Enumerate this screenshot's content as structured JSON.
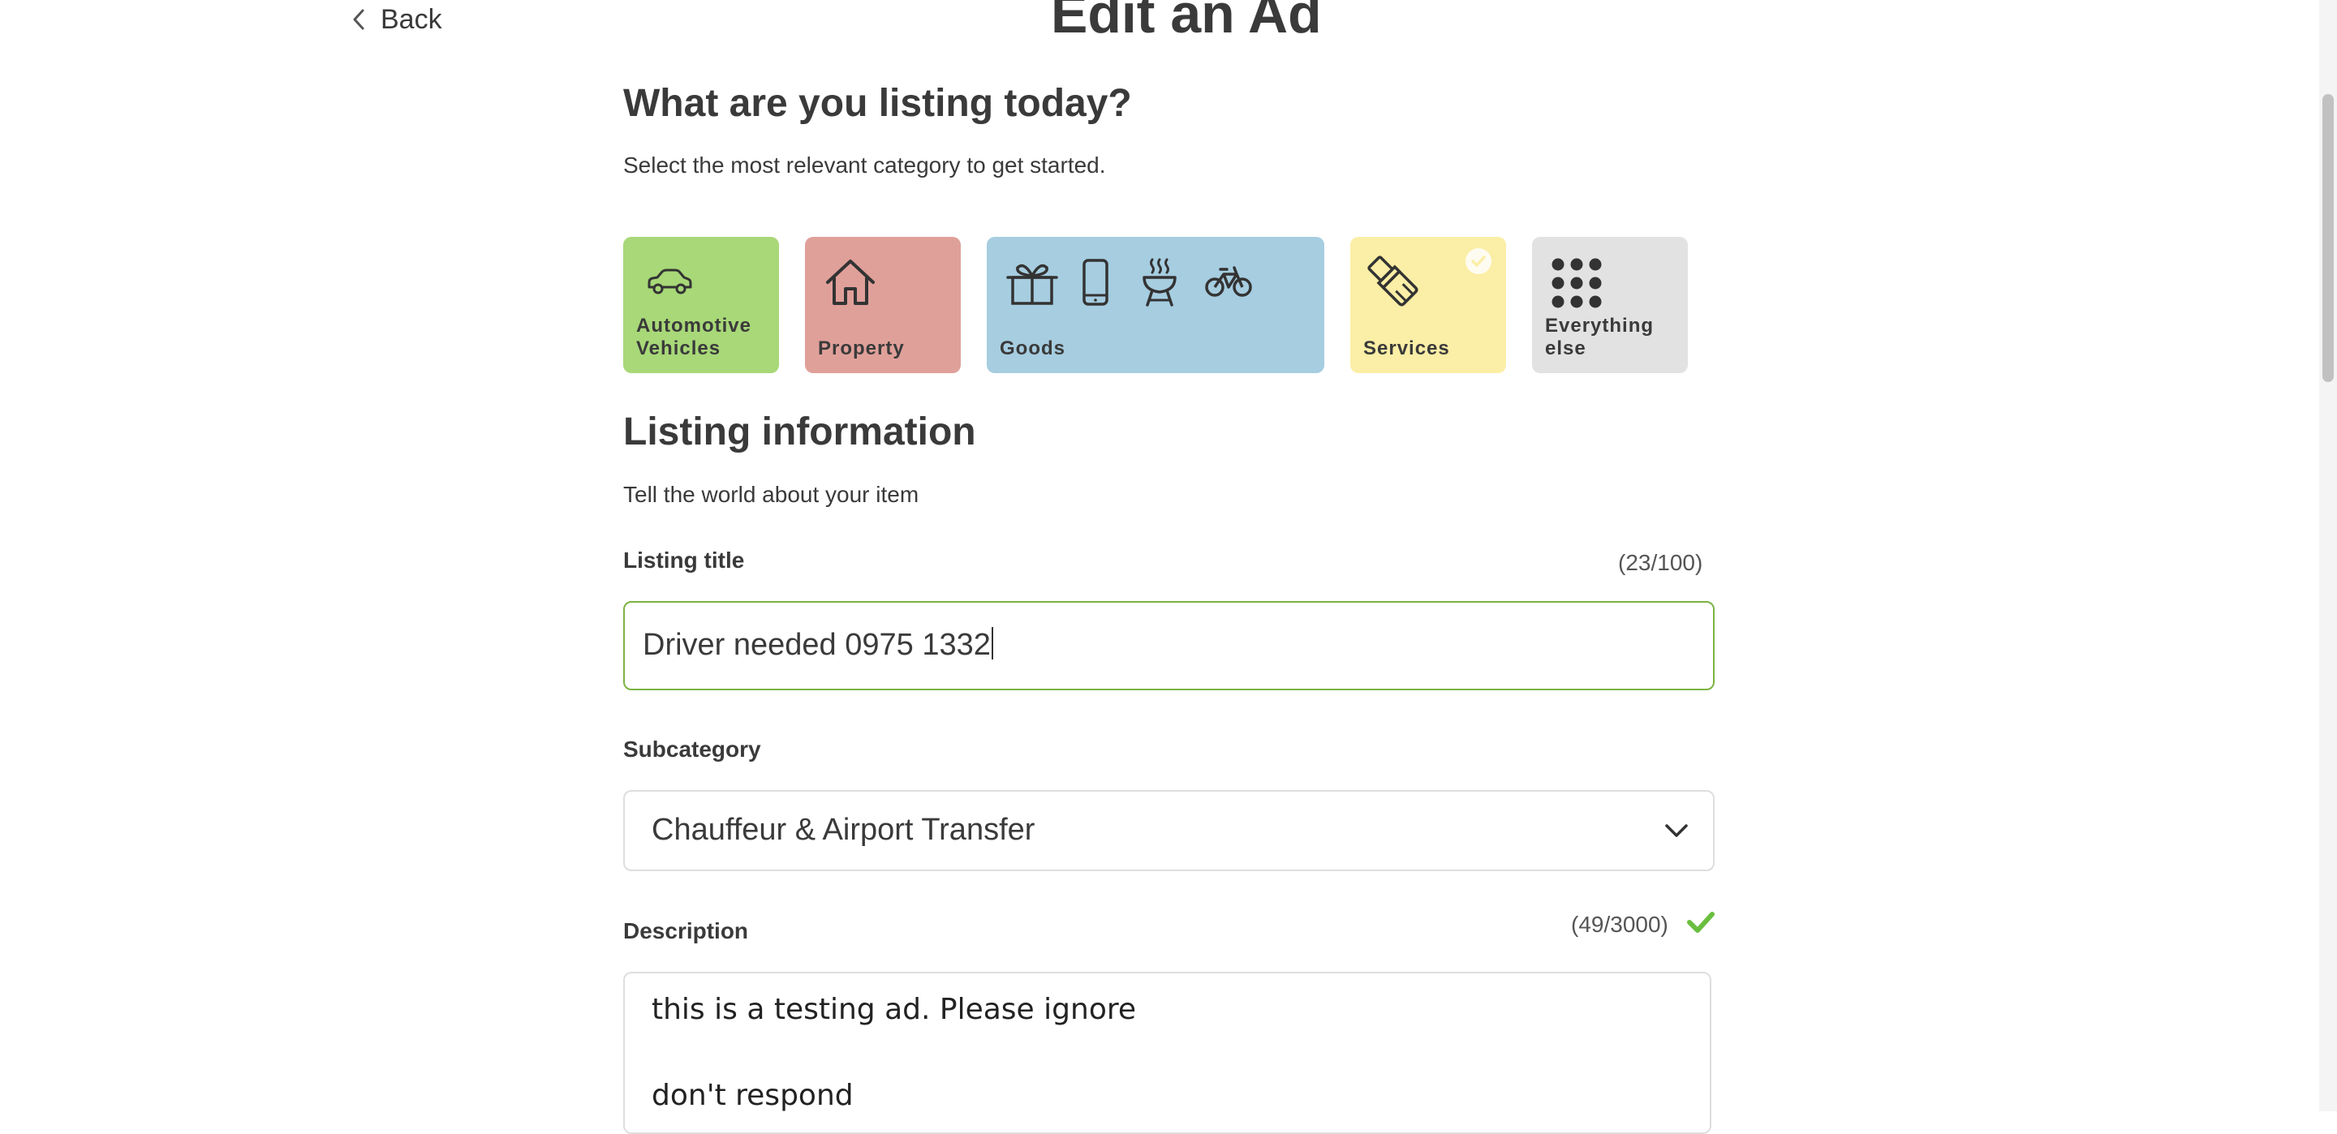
{
  "nav": {
    "back_label": "Back"
  },
  "page": {
    "title": "Edit an Ad"
  },
  "category_section": {
    "heading": "What are you listing today?",
    "subheading": "Select the most relevant category to get started.",
    "tiles": [
      {
        "label": "Automotive Vehicles",
        "color": "#a8d878",
        "icon": "car-icon"
      },
      {
        "label": "Property",
        "color": "#e0a09a",
        "icon": "house-icon"
      },
      {
        "label": "Goods",
        "color": "#a6cde0",
        "icon": "goods-icons"
      },
      {
        "label": "Services",
        "color": "#fbeea6",
        "icon": "paintbrush-icon",
        "selected": true
      },
      {
        "label": "Everything else",
        "color": "#e2e2e2",
        "icon": "grid-dots-icon"
      }
    ]
  },
  "listing_section": {
    "heading": "Listing information",
    "subheading": "Tell the world about your item",
    "title_field": {
      "label": "Listing title",
      "counter": "(23/100)",
      "value": "Driver needed 0975 1332"
    },
    "subcategory_field": {
      "label": "Subcategory",
      "value": "Chauffeur & Airport Transfer"
    },
    "description_field": {
      "label": "Description",
      "counter": "(49/3000)",
      "lines": [
        "this is a testing ad. Please ignore",
        "don't respond"
      ]
    }
  },
  "colors": {
    "valid_green": "#7cb342",
    "check_green": "#6abf3f"
  }
}
